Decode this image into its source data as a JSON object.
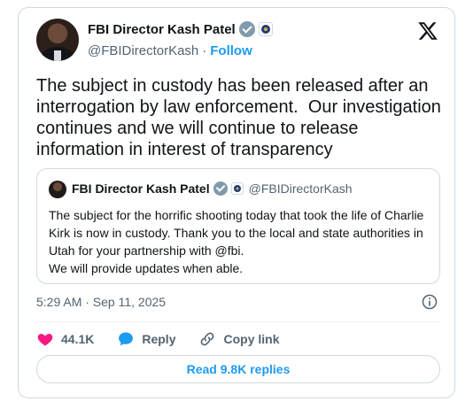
{
  "author": {
    "name": "FBI Director Kash Patel",
    "handle": "@FBIDirectorKash",
    "separator": "·",
    "follow_label": "Follow"
  },
  "tweet": {
    "text": "The subject in custody has been released after an interrogation by law enforcement.  Our investigation continues and we will continue to release information in interest of transparency",
    "timestamp": "5:29 AM · Sep 11, 2025"
  },
  "quoted_tweet": {
    "name": "FBI Director Kash Patel",
    "handle": "@FBIDirectorKash",
    "text": "The subject for the horrific shooting today that took the life of Charlie Kirk is now in custody. Thank you to the local and state authorities in Utah for your partnership with @fbi.\nWe will provide updates when able."
  },
  "actions": {
    "likes": "44.1K",
    "reply_label": "Reply",
    "copy_link_label": "Copy link"
  },
  "replies_button_label": "Read 9.8K replies",
  "colors": {
    "accent": "#1d9bf0",
    "like": "#f91880",
    "muted": "#536471",
    "border": "#cfd9de"
  },
  "icons": [
    "x-logo-icon",
    "verified-badge-icon",
    "fbi-seal-icon",
    "info-icon",
    "heart-icon",
    "reply-bubble-icon",
    "link-icon"
  ]
}
